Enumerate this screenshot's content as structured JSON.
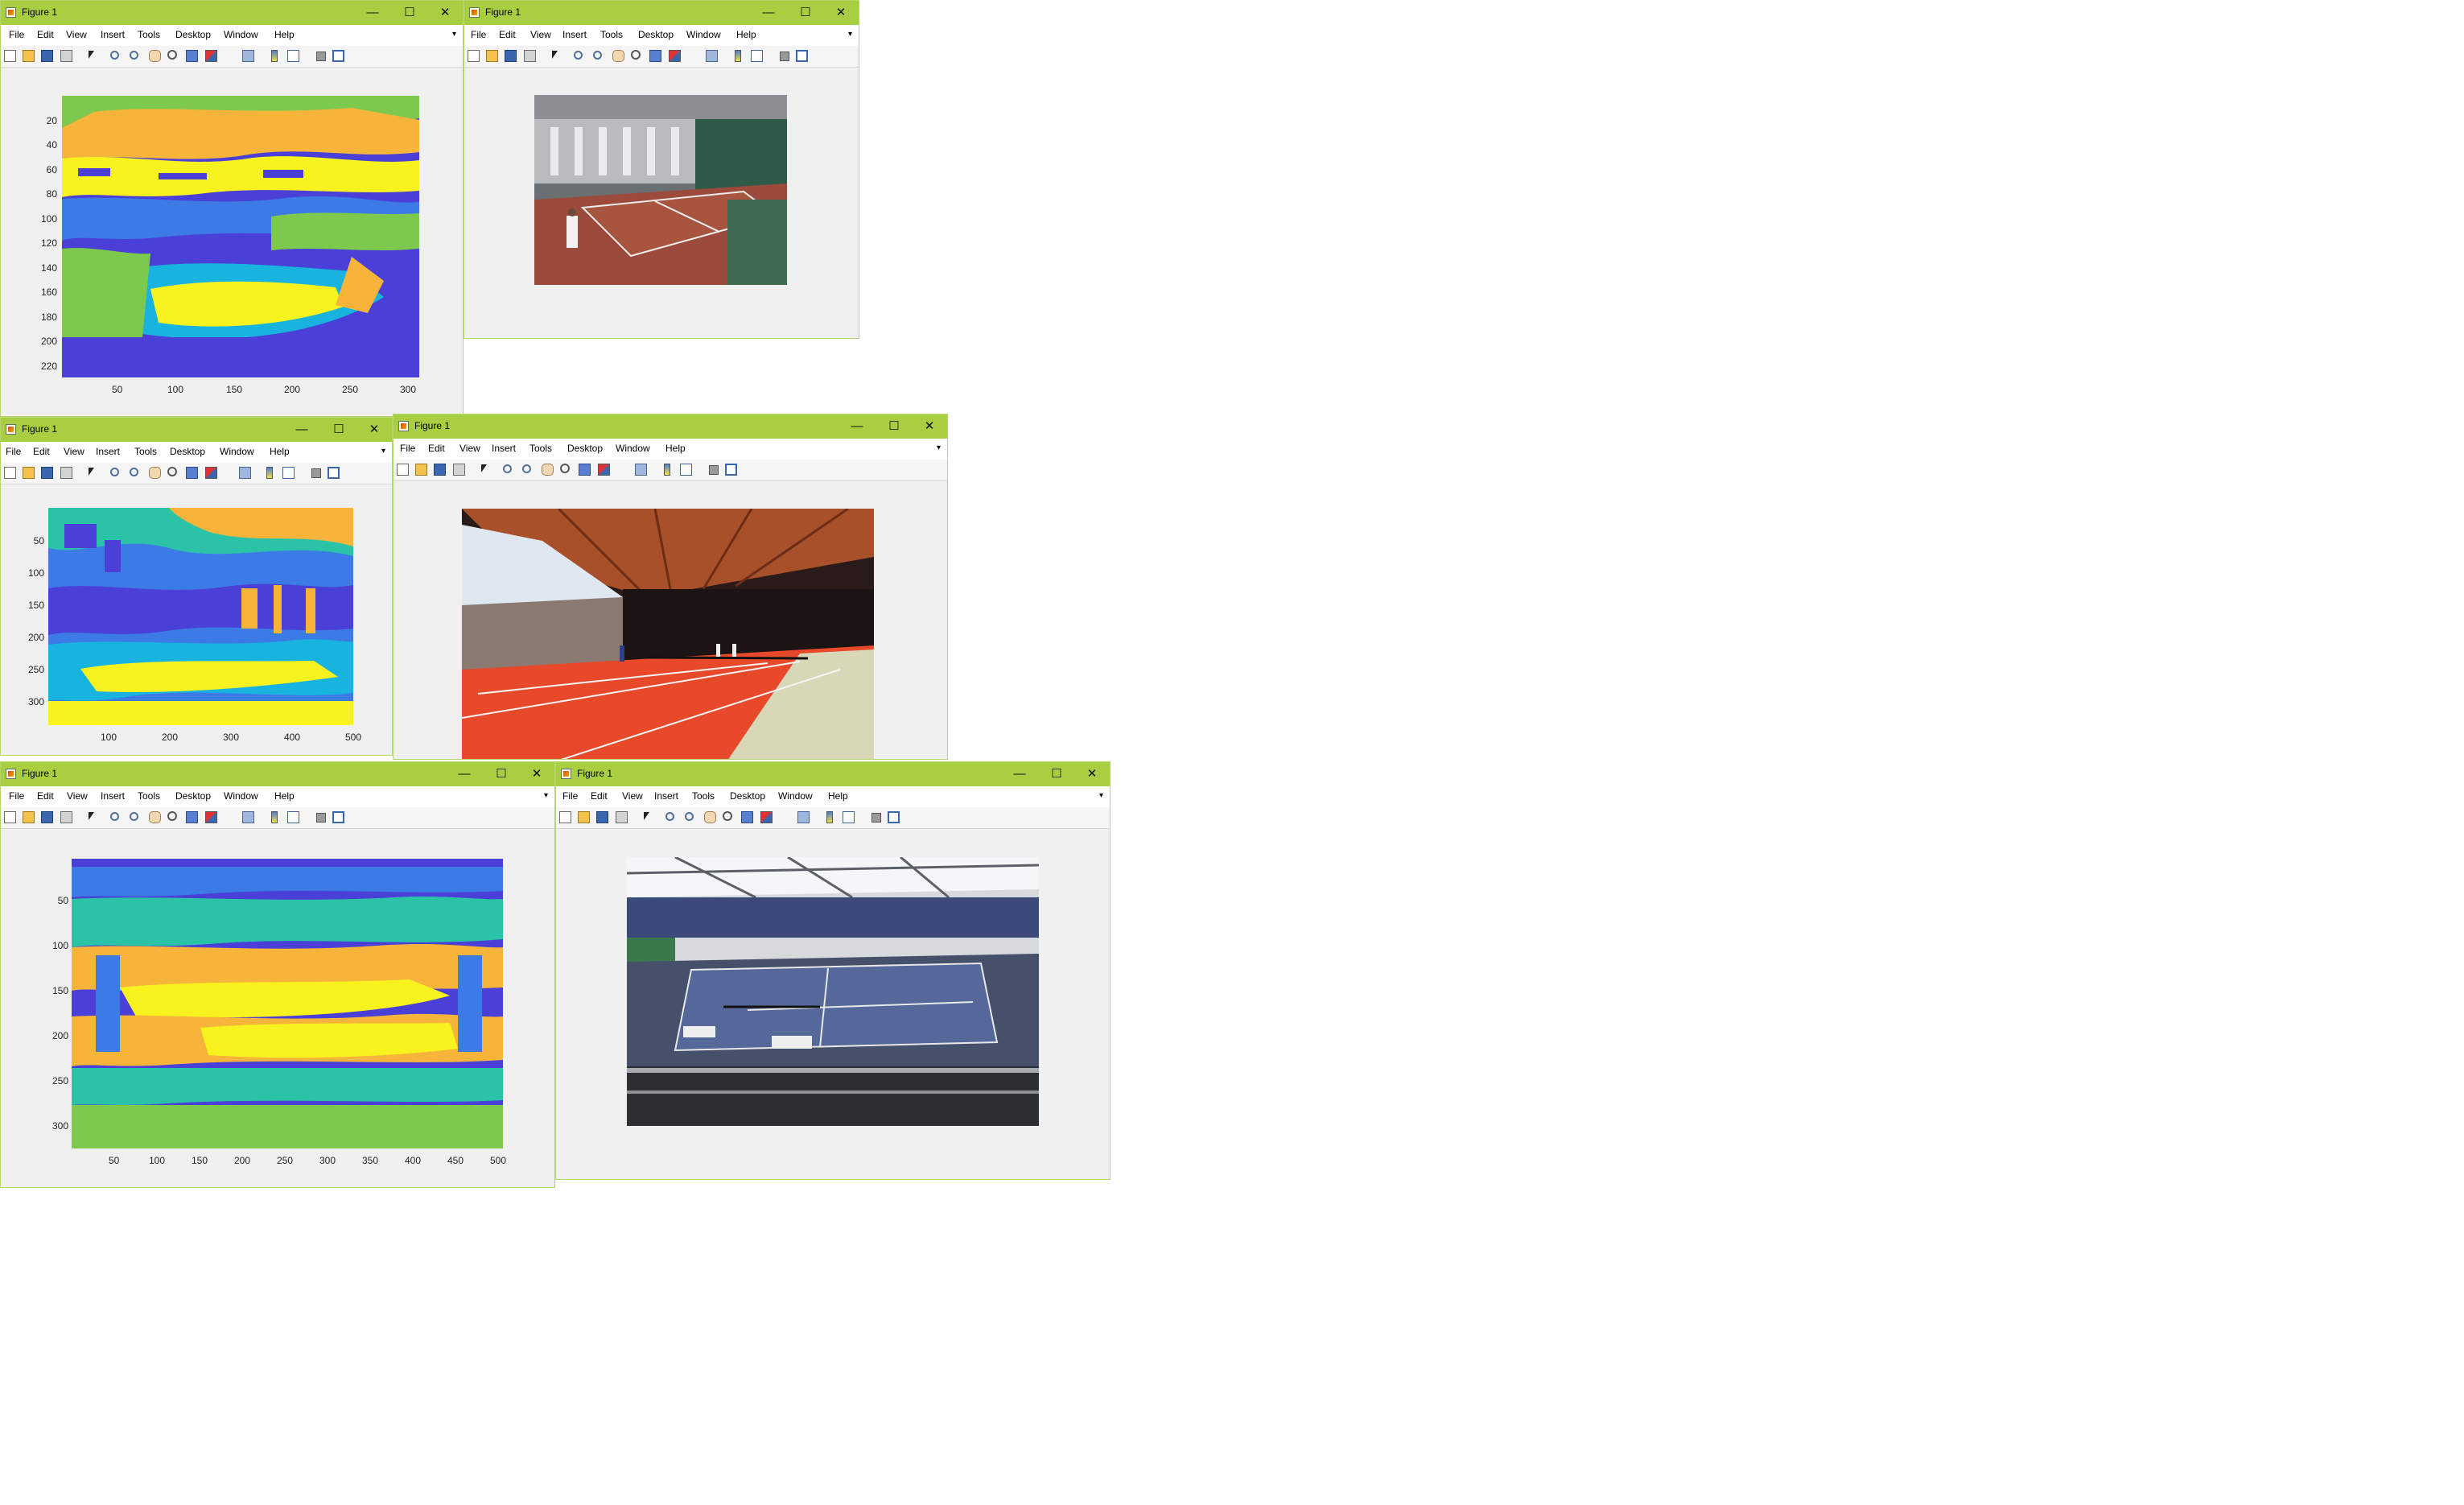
{
  "window_title": "Figure 1",
  "controls": {
    "minimize": "—",
    "maximize": "☐",
    "close": "✕"
  },
  "menu": [
    "File",
    "Edit",
    "View",
    "Insert",
    "Tools",
    "Desktop",
    "Window",
    "Help"
  ],
  "menu_overflow": "▾",
  "toolbar_icons": [
    "new-figure-icon",
    "open-icon",
    "save-icon",
    "print-icon",
    "pointer-icon",
    "zoom-in-icon",
    "zoom-out-icon",
    "pan-icon",
    "rotate-icon",
    "data-cursor-icon",
    "brush-icon",
    "dropdown-arrow-icon",
    "link-plot-icon",
    "colorbar-icon",
    "legend-icon",
    "hide-plot-tools-icon",
    "show-plot-tools-icon"
  ],
  "palette": {
    "dark_blue": "#4a3fd6",
    "blue": "#3c7be6",
    "cyan": "#19b3e0",
    "teal": "#2bc3a8",
    "green": "#7cc94e",
    "orange": "#f6b43b",
    "yellow": "#f8f21e"
  },
  "figures": [
    {
      "id": "fig1",
      "kind": "segmentation",
      "y_ticks": [
        "20",
        "40",
        "60",
        "80",
        "100",
        "120",
        "140",
        "160",
        "180",
        "200",
        "220"
      ],
      "x_ticks": [
        "50",
        "100",
        "150",
        "200",
        "250",
        "300"
      ]
    },
    {
      "id": "fig2",
      "kind": "photo",
      "scene": "red clay indoor tennis court"
    },
    {
      "id": "fig3",
      "kind": "segmentation",
      "y_ticks": [
        "50",
        "100",
        "150",
        "200",
        "250",
        "300"
      ],
      "x_ticks": [
        "100",
        "200",
        "300",
        "400",
        "500"
      ]
    },
    {
      "id": "fig4",
      "kind": "photo",
      "scene": "orange indoor tennis court with wooden roof"
    },
    {
      "id": "fig5",
      "kind": "segmentation",
      "y_ticks": [
        "50",
        "100",
        "150",
        "200",
        "250",
        "300"
      ],
      "x_ticks": [
        "50",
        "100",
        "150",
        "200",
        "250",
        "300",
        "350",
        "400",
        "450",
        "500"
      ]
    },
    {
      "id": "fig6",
      "kind": "photo",
      "scene": "blue indoor tennis hall seen from balcony"
    }
  ]
}
